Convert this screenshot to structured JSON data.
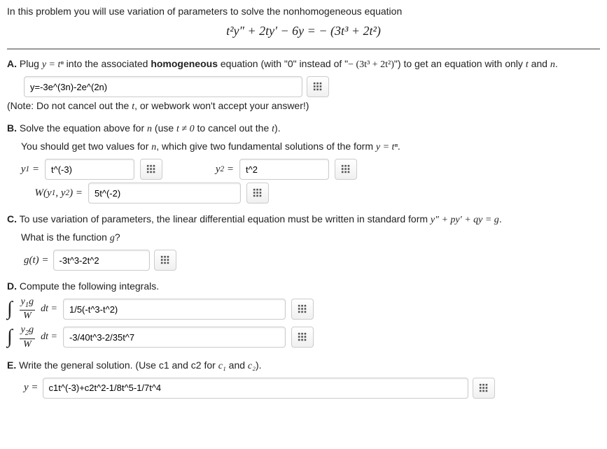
{
  "intro": "In this problem you will use variation of parameters to solve the nonhomogeneous equation",
  "main_eq": "t²y″ + 2ty′ − 6y = − (3t³ + 2t²)",
  "A": {
    "label": "A.",
    "text1": " Plug ",
    "plug": "y = tⁿ",
    "text2": " into the associated ",
    "homog": "homogeneous",
    "text3": " equation (with \"0\" instead of \"",
    "rhs": "− (3t³ + 2t²)",
    "text4": "\") to get an equation with only ",
    "t": "t",
    "and": " and ",
    "n": "n",
    "period": ".",
    "input": "y=-3e^(3n)-2e^(2n)",
    "note": "(Note: Do not cancel out the ",
    "note_t": "t",
    "note_end": ", or webwork won't accept your answer!)"
  },
  "B": {
    "label": "B.",
    "line1a": " Solve the equation above for ",
    "n": "n",
    "line1b": " (use ",
    "tneq": "t ≠ 0",
    "line1c": " to cancel out the ",
    "t": "t",
    "line1d": ").",
    "line2a": "You should get two values for ",
    "line2b": ", which give two fundamental solutions of the form ",
    "form": "y = tⁿ",
    "period": ".",
    "y1_label": "y₁ =",
    "y1_value": "t^(-3)",
    "y2_label": "y₂ =",
    "y2_value": "t^2",
    "w_label": "W(y₁, y₂) =",
    "w_value": "5t^(-2)"
  },
  "C": {
    "label": "C.",
    "text1": " To use variation of parameters, the linear differential equation must be written in standard form ",
    "std": "y″ + py′ + qy = g",
    "period": ".",
    "line2": "What is the function ",
    "g": "g",
    "q": "?",
    "g_label": "g(t) =",
    "g_value": "-3t^3-2t^2"
  },
  "D": {
    "label": "D.",
    "text": " Compute the following integrals.",
    "i1_num": "y₁g",
    "i1_den": "W",
    "dt": "dt =",
    "i1_value": "1/5(-t^3-t^2)",
    "i2_num": "y₂g",
    "i2_den": "W",
    "i2_value": "-3/40t^3-2/35t^7"
  },
  "E": {
    "label": "E.",
    "text1": " Write the general solution. (Use c1 and c2 for ",
    "c1": "c₁",
    "and": " and ",
    "c2": "c₂",
    "end": ").",
    "y_label": "y =",
    "y_value": "c1t^(-3)+c2t^2-1/8t^5-1/7t^4"
  }
}
